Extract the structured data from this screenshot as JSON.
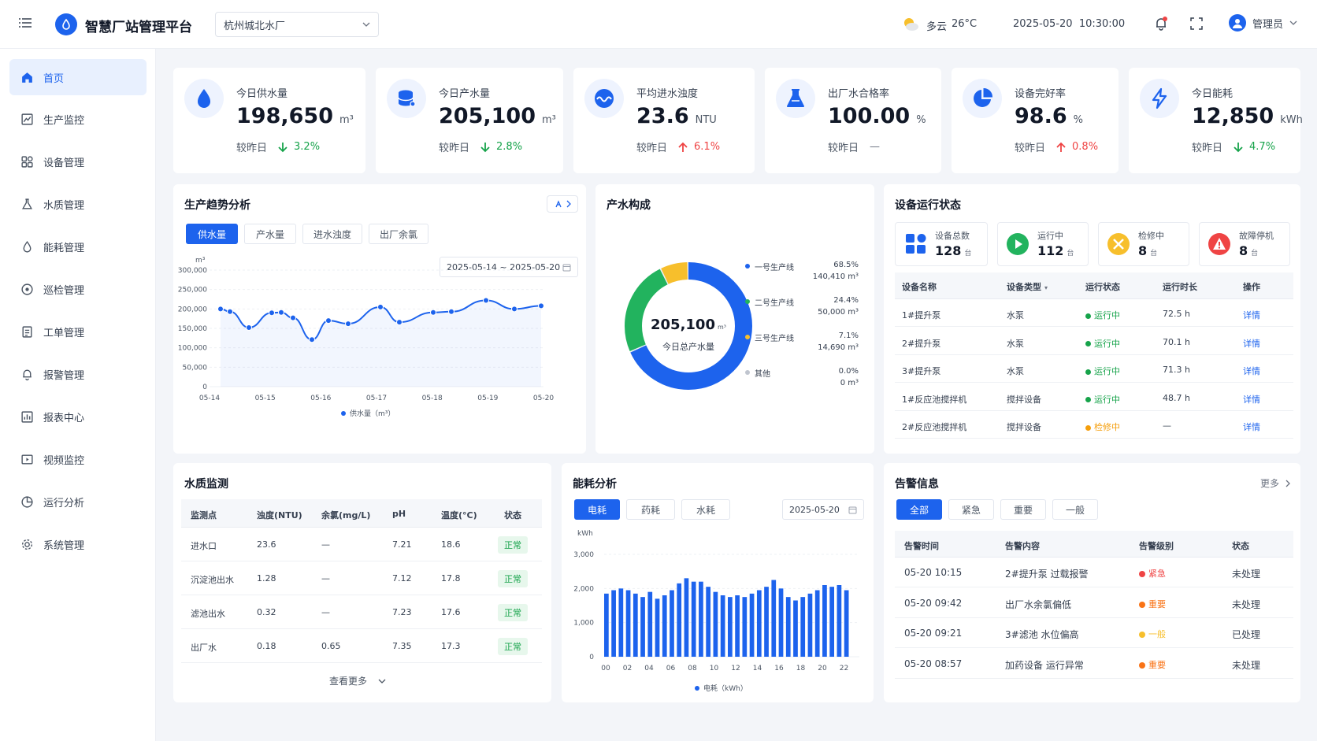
{
  "header": {
    "title": "智慧厂站管理平台",
    "plant": "杭州城北水厂",
    "weather": "多云",
    "temp": "26°C",
    "datetime": "2025-05-20  10:30:00",
    "user": "管理员"
  },
  "nav": [
    "首页",
    "生产监控",
    "设备管理",
    "水质管理",
    "能耗管理",
    "巡检管理",
    "工单管理",
    "报警管理",
    "报表中心",
    "视频监控",
    "运行分析",
    "系统管理"
  ],
  "kpis": [
    {
      "label": "今日供水量",
      "value": "198,650",
      "unit": "m³",
      "cmp": "较昨日",
      "dir": "down",
      "pct": "3.2%",
      "icon": "water-drop-icon"
    },
    {
      "label": "今日产水量",
      "value": "205,100",
      "unit": "m³",
      "cmp": "较昨日",
      "dir": "down",
      "pct": "2.8%",
      "icon": "tank-icon"
    },
    {
      "label": "平均进水浊度",
      "value": "23.6",
      "unit": "NTU",
      "cmp": "较昨日",
      "dir": "up",
      "pct": "6.1%",
      "icon": "wave-icon"
    },
    {
      "label": "出厂水合格率",
      "value": "100.00",
      "unit": "%",
      "cmp": "较昨日",
      "dir": "flat",
      "pct": "—",
      "icon": "flask-icon"
    },
    {
      "label": "设备完好率",
      "value": "98.6",
      "unit": "%",
      "cmp": "较昨日",
      "dir": "up",
      "pct": "0.8%",
      "icon": "pie-icon"
    },
    {
      "label": "今日能耗",
      "value": "12,850",
      "unit": "kWh",
      "cmp": "较昨日",
      "dir": "down",
      "pct": "4.7%",
      "icon": "lightning-icon"
    }
  ],
  "trend": {
    "title": "生产趋势分析",
    "tabs": [
      "供水量",
      "产水量",
      "进水浊度",
      "出厂余氯"
    ],
    "range": "2025-05-14 ~ 2025-05-20",
    "unit": "m³",
    "legend": "供水量（m³）"
  },
  "composition": {
    "title": "产水构成",
    "center_value": "205,100",
    "center_unit": "m³",
    "center_label": "今日总产水量",
    "items": [
      {
        "name": "一号生产线",
        "pct": "68.5%",
        "val": "140,410 m³",
        "color": "#1d63ed"
      },
      {
        "name": "二号生产线",
        "pct": "24.4%",
        "val": "50,000 m³",
        "color": "#22b35e"
      },
      {
        "name": "三号生产线",
        "pct": "7.1%",
        "val": "14,690 m³",
        "color": "#f7bf2c"
      },
      {
        "name": "其他",
        "pct": "0.0%",
        "val": "0 m³",
        "color": "#c0c5cf"
      }
    ]
  },
  "equip": {
    "title": "设备运行状态",
    "stats": [
      {
        "label": "设备总数",
        "value": "128",
        "unit": "台"
      },
      {
        "label": "运行中",
        "value": "112",
        "unit": "台"
      },
      {
        "label": "检修中",
        "value": "8",
        "unit": "台"
      },
      {
        "label": "故障停机",
        "value": "8",
        "unit": "台"
      }
    ],
    "cols": [
      "设备名称",
      "设备类型",
      "运行状态",
      "运行时长",
      "操作"
    ],
    "rows": [
      {
        "name": "1#提升泵",
        "type": "水泵",
        "status": "运行中",
        "dur": "72.5 h",
        "op": "详情"
      },
      {
        "name": "2#提升泵",
        "type": "水泵",
        "status": "运行中",
        "dur": "70.1 h",
        "op": "详情"
      },
      {
        "name": "3#提升泵",
        "type": "水泵",
        "status": "运行中",
        "dur": "71.3 h",
        "op": "详情"
      },
      {
        "name": "1#反应池搅拌机",
        "type": "搅拌设备",
        "status": "运行中",
        "dur": "48.7 h",
        "op": "详情"
      },
      {
        "name": "2#反应池搅拌机",
        "type": "搅拌设备",
        "status": "检修中",
        "dur": "—",
        "op": "详情"
      }
    ]
  },
  "water": {
    "title": "水质监测",
    "cols": [
      "监测点",
      "浊度(NTU)",
      "余氯(mg/L)",
      "pH",
      "温度(°C)",
      "状态"
    ],
    "rows": [
      [
        "进水口",
        "23.6",
        "—",
        "7.21",
        "18.6",
        "正常"
      ],
      [
        "沉淀池出水",
        "1.28",
        "—",
        "7.12",
        "17.8",
        "正常"
      ],
      [
        "滤池出水",
        "0.32",
        "—",
        "7.23",
        "17.6",
        "正常"
      ],
      [
        "出厂水",
        "0.18",
        "0.65",
        "7.35",
        "17.3",
        "正常"
      ]
    ],
    "more": "查看更多"
  },
  "energy": {
    "title": "能耗分析",
    "tabs": [
      "电耗",
      "药耗",
      "水耗"
    ],
    "date": "2025-05-20",
    "unit": "kWh",
    "legend": "电耗（kWh）"
  },
  "alarm": {
    "title": "告警信息",
    "more": "更多",
    "tabs": [
      "全部",
      "紧急",
      "重要",
      "一般"
    ],
    "cols": [
      "告警时间",
      "告警内容",
      "告警级别",
      "状态"
    ],
    "rows": [
      {
        "time": "05-20 10:15",
        "content": "2#提升泵 过载报警",
        "level": "紧急",
        "color": "#ef4444",
        "state": "未处理"
      },
      {
        "time": "05-20 09:42",
        "content": "出厂水余氯偏低",
        "level": "重要",
        "color": "#f97316",
        "state": "未处理"
      },
      {
        "time": "05-20 09:21",
        "content": "3#滤池 水位偏高",
        "level": "一般",
        "color": "#f7bf2c",
        "state": "已处理"
      },
      {
        "time": "05-20 08:57",
        "content": "加药设备 运行异常",
        "level": "重要",
        "color": "#f97316",
        "state": "未处理"
      }
    ]
  },
  "chart_data": [
    {
      "type": "line",
      "title": "生产趋势分析",
      "series": [
        {
          "name": "供水量（m³）",
          "values": [
            200000,
            193000,
            152000,
            190000,
            191000,
            177000,
            121000,
            170000,
            162000,
            205000,
            166000,
            191000,
            193000,
            222000,
            200000,
            208000
          ]
        }
      ],
      "x": [
        "05-14",
        "05-14",
        "05-15",
        "05-15",
        "05-15",
        "05-16",
        "05-16",
        "05-16",
        "05-17",
        "05-17",
        "05-17",
        "05-18",
        "05-18",
        "05-19",
        "05-19",
        "05-20"
      ],
      "xticks": [
        "05-14",
        "05-15",
        "05-16",
        "05-17",
        "05-18",
        "05-19",
        "05-20"
      ],
      "yticks": [
        "0",
        "50,000",
        "100,000",
        "150,000",
        "200,000",
        "250,000",
        "300,000"
      ],
      "ylim": [
        0,
        300000
      ],
      "ylabel": "m³"
    },
    {
      "type": "pie",
      "title": "产水构成",
      "categories": [
        "一号生产线",
        "二号生产线",
        "三号生产线",
        "其他"
      ],
      "values": [
        68.5,
        24.4,
        7.1,
        0.0
      ]
    },
    {
      "type": "bar",
      "title": "能耗分析",
      "series": [
        {
          "name": "电耗（kWh）",
          "values": [
            1850,
            1950,
            2000,
            1950,
            1850,
            1750,
            1900,
            1700,
            1800,
            1950,
            2150,
            2300,
            2200,
            2200,
            2050,
            1900,
            1800,
            1750,
            1800,
            1750,
            1850,
            1950,
            2050,
            2250,
            2000,
            1750,
            1650,
            1750,
            1850,
            1950,
            2100,
            2050,
            2100,
            1950
          ]
        }
      ],
      "xticks": [
        "00",
        "02",
        "04",
        "06",
        "08",
        "10",
        "12",
        "14",
        "16",
        "18",
        "20",
        "22"
      ],
      "yticks": [
        "0",
        "1,000",
        "2,000",
        "3,000"
      ],
      "ylim": [
        0,
        3000
      ],
      "ylabel": "kWh"
    }
  ]
}
